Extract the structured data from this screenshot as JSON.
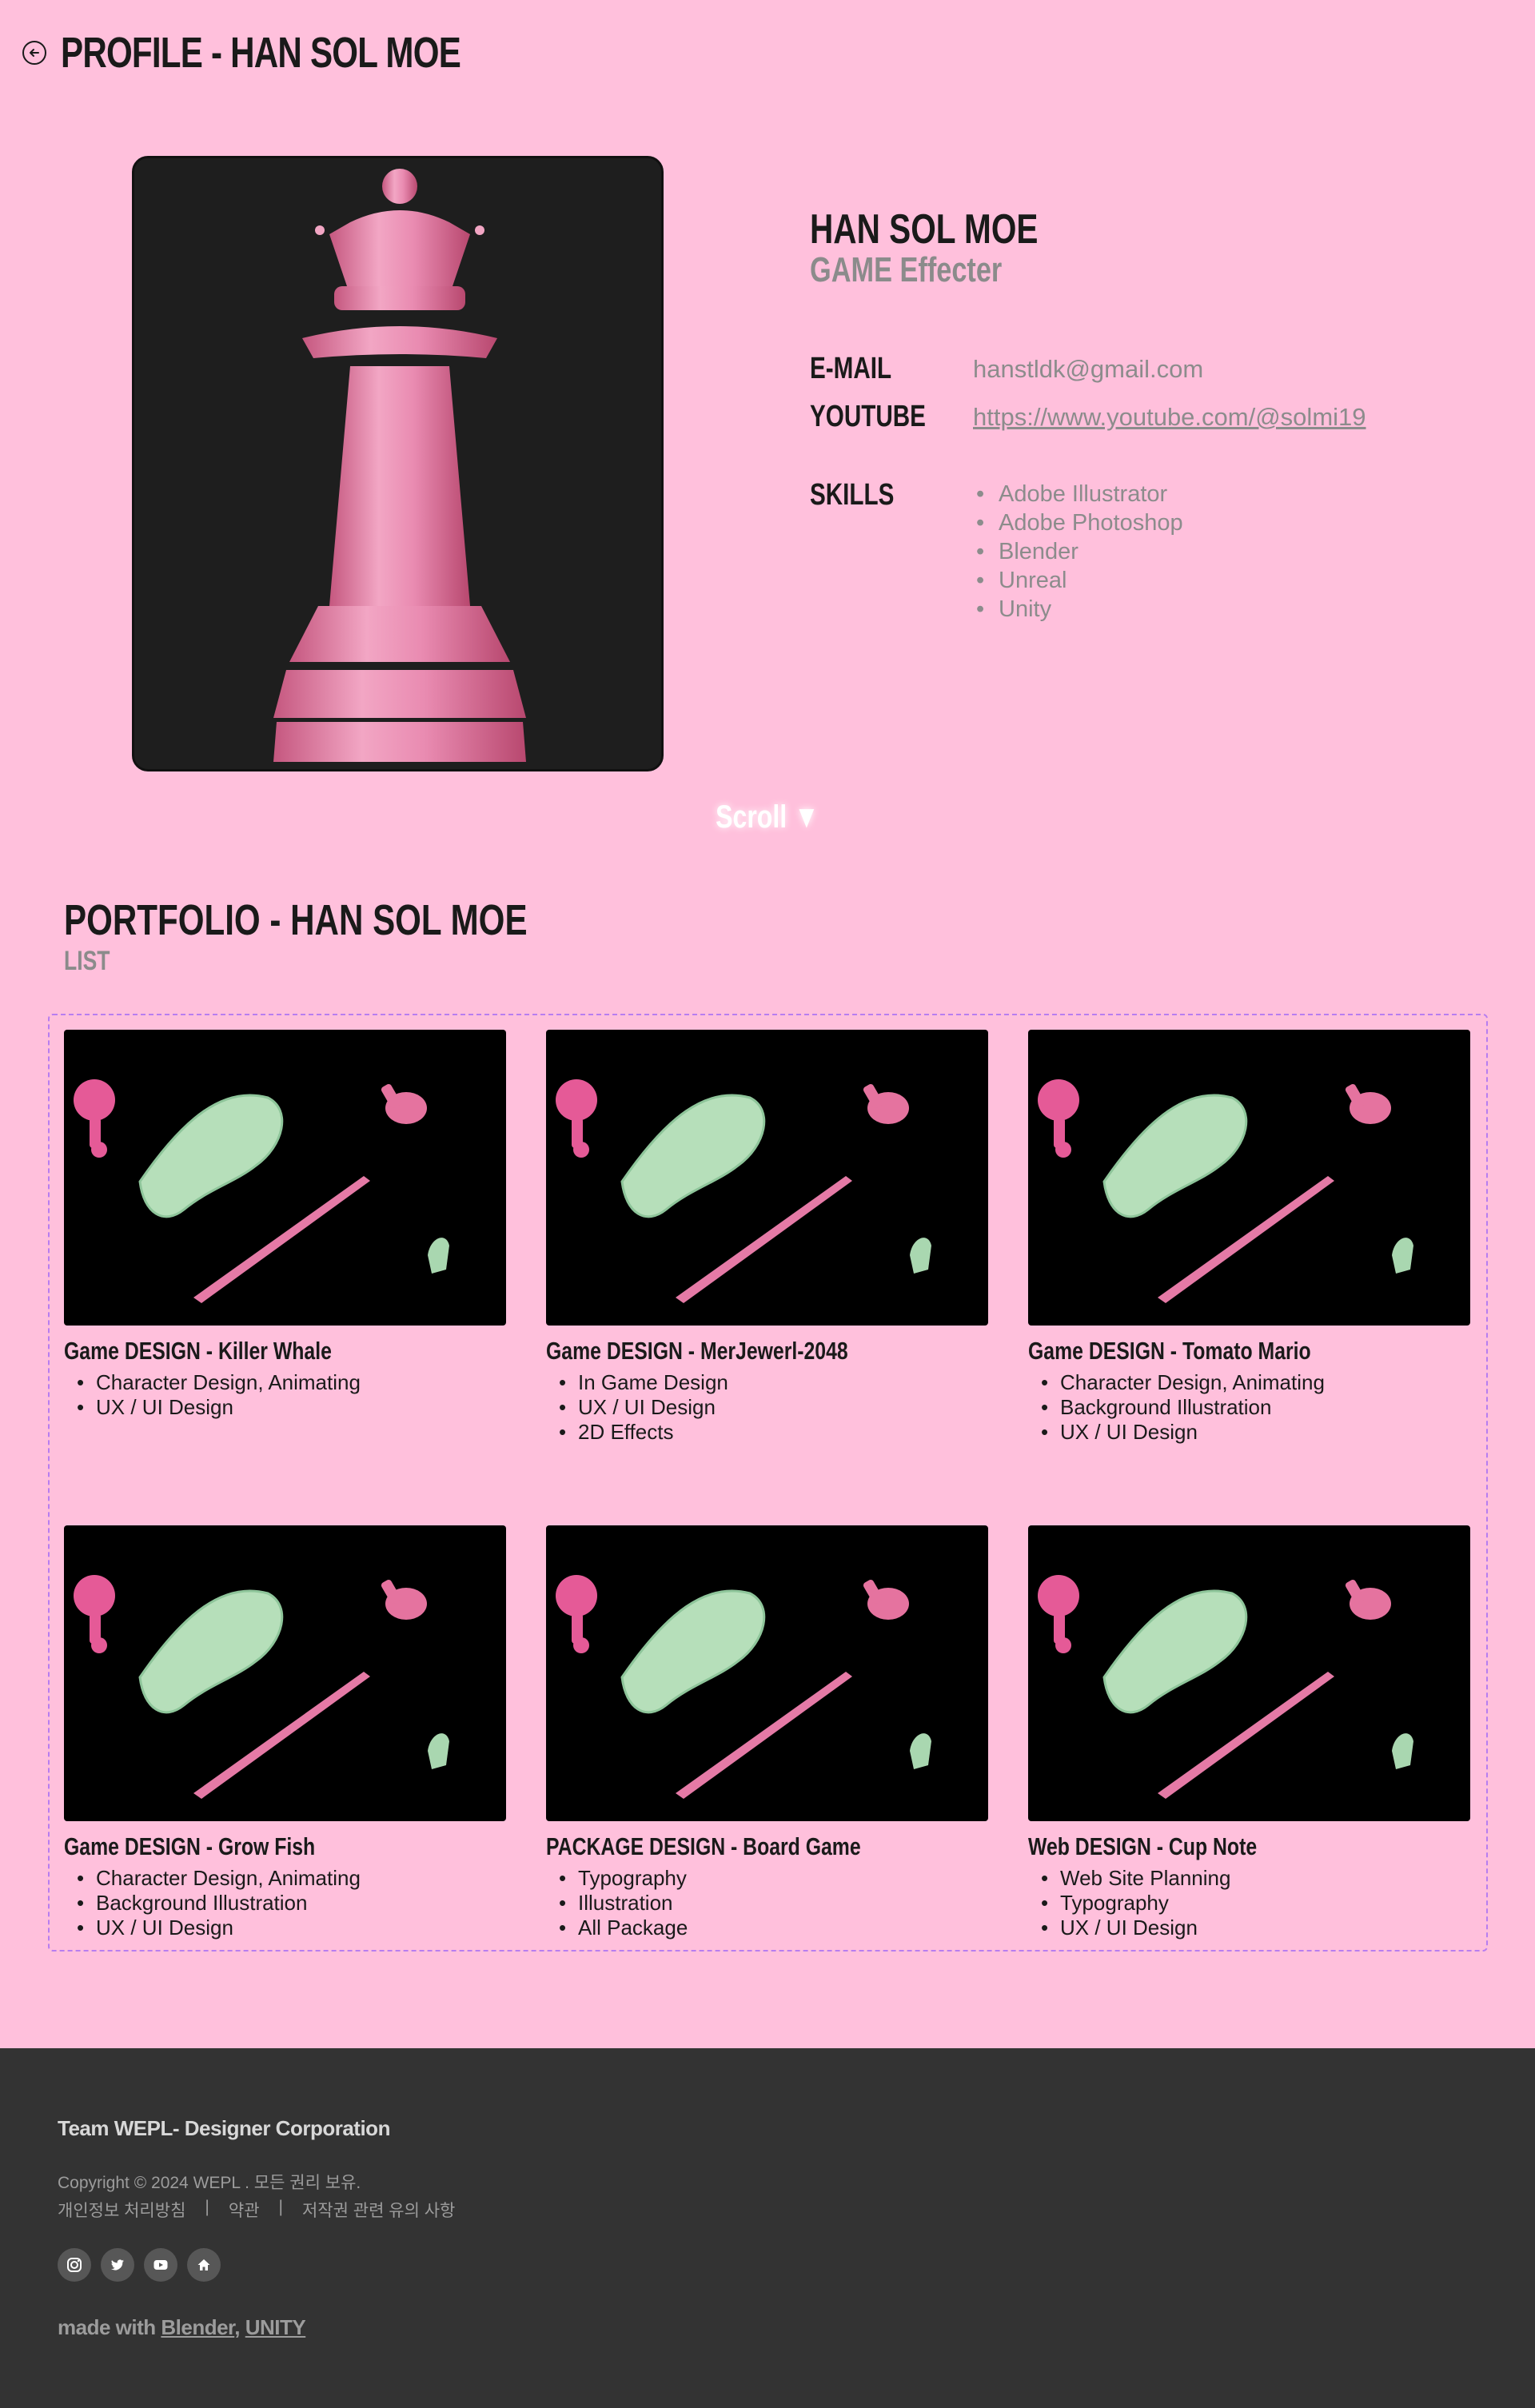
{
  "header": {
    "title": "PROFILE - HAN SOL MOE"
  },
  "profile": {
    "name": "HAN SOL MOE",
    "role": "GAME Effecter",
    "email_label": "E-MAIL",
    "email": "hanstldk@gmail.com",
    "youtube_label": "YOUTUBE",
    "youtube": "https://www.youtube.com/@solmi19",
    "skills_label": "SKILLS",
    "skills": [
      "Adobe Illustrator",
      "Adobe Photoshop",
      "Blender",
      "Unreal",
      "Unity"
    ]
  },
  "scroll": {
    "label": "Scroll ▼"
  },
  "portfolio": {
    "title": "PORTFOLIO - HAN SOL MOE",
    "subtitle": "LIST",
    "items": [
      {
        "title": "Game DESIGN - Killer Whale",
        "tags": [
          "Character Design, Animating",
          "UX / UI Design"
        ]
      },
      {
        "title": "Game DESIGN - MerJewerl-2048",
        "tags": [
          "In Game Design",
          "UX / UI Design",
          "2D Effects"
        ]
      },
      {
        "title": "Game DESIGN - Tomato Mario",
        "tags": [
          "Character Design, Animating",
          "Background Illustration",
          "UX / UI Design"
        ]
      },
      {
        "title": "Game DESIGN - Grow Fish",
        "tags": [
          "Character Design, Animating",
          "Background Illustration",
          "UX / UI Design"
        ]
      },
      {
        "title": "PACKAGE DESIGN - Board Game",
        "tags": [
          "Typography",
          " Illustration",
          "All Package"
        ]
      },
      {
        "title": "Web DESIGN - Cup Note",
        "tags": [
          "Web Site Planning",
          "Typography",
          "UX / UI Design"
        ]
      }
    ]
  },
  "footer": {
    "team": "Team WEPL- Designer Corporation",
    "copyright": "Copyright © 2024 WEPL . 모든 권리 보유.",
    "links": [
      "개인정보 처리방침",
      "약관",
      "저작권 관련 유의 사항"
    ],
    "separator": "|",
    "socials": [
      "instagram-icon",
      "twitter-icon",
      "youtube-icon",
      "home-icon"
    ],
    "made_prefix": "made with",
    "made_blender": "Blender",
    "made_comma": ",",
    "made_unity": "UNITY"
  },
  "colors": {
    "background": "#ffc0dc",
    "footer": "#333333",
    "accent_dashed": "#b77ef0",
    "muted": "#8c8c8c"
  }
}
